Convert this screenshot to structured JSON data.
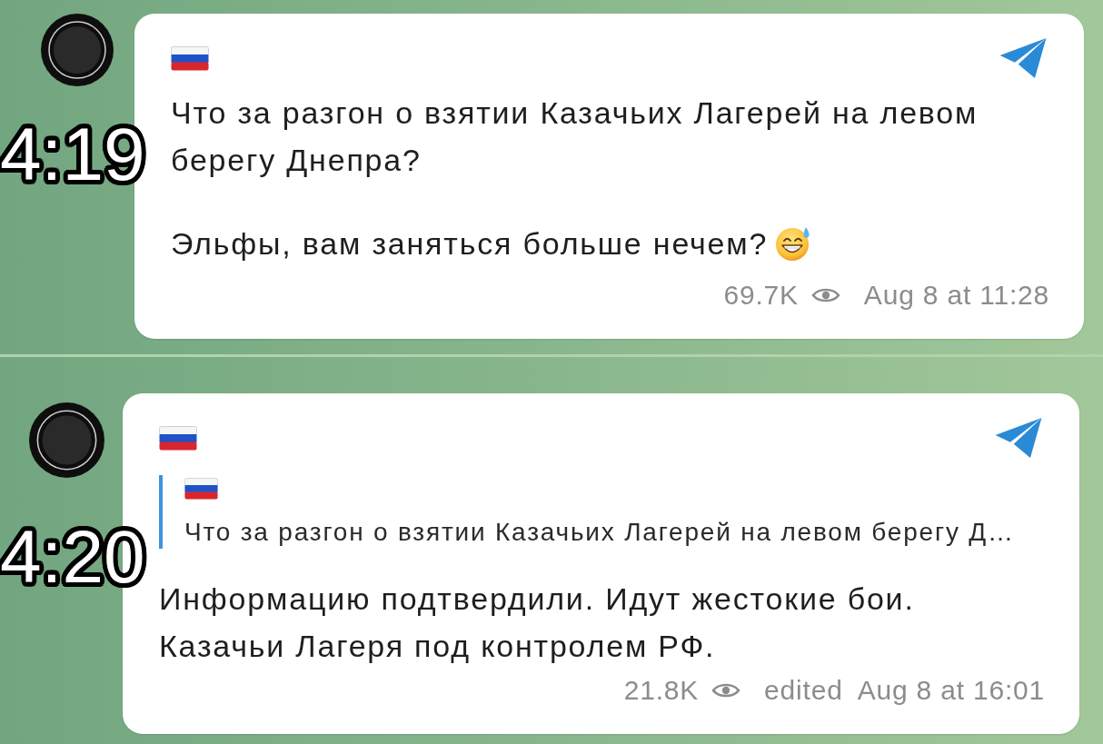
{
  "messages": [
    {
      "time_overlay": "4:19",
      "paragraphs": [
        {
          "text": "Что за разгон о взятии Казачьих Лагерей на левом берегу Днепра?",
          "emoji": false
        },
        {
          "text": "Эльфы, вам заняться больше нечем?",
          "emoji": true
        }
      ],
      "views": "69.7K",
      "date": "Aug 8 at 11:28"
    },
    {
      "time_overlay": "4:20",
      "reply": {
        "text": "Что за разгон о взятии Казачьих Лагерей на левом берегу Д…"
      },
      "paragraphs": [
        {
          "text": "Информацию подтвердили. Идут жестокие бои.\nКазачьи Лагеря под контролем РФ.",
          "emoji": false
        }
      ],
      "views": "21.8K",
      "edited": "edited",
      "date": "Aug 8 at 16:01"
    }
  ]
}
